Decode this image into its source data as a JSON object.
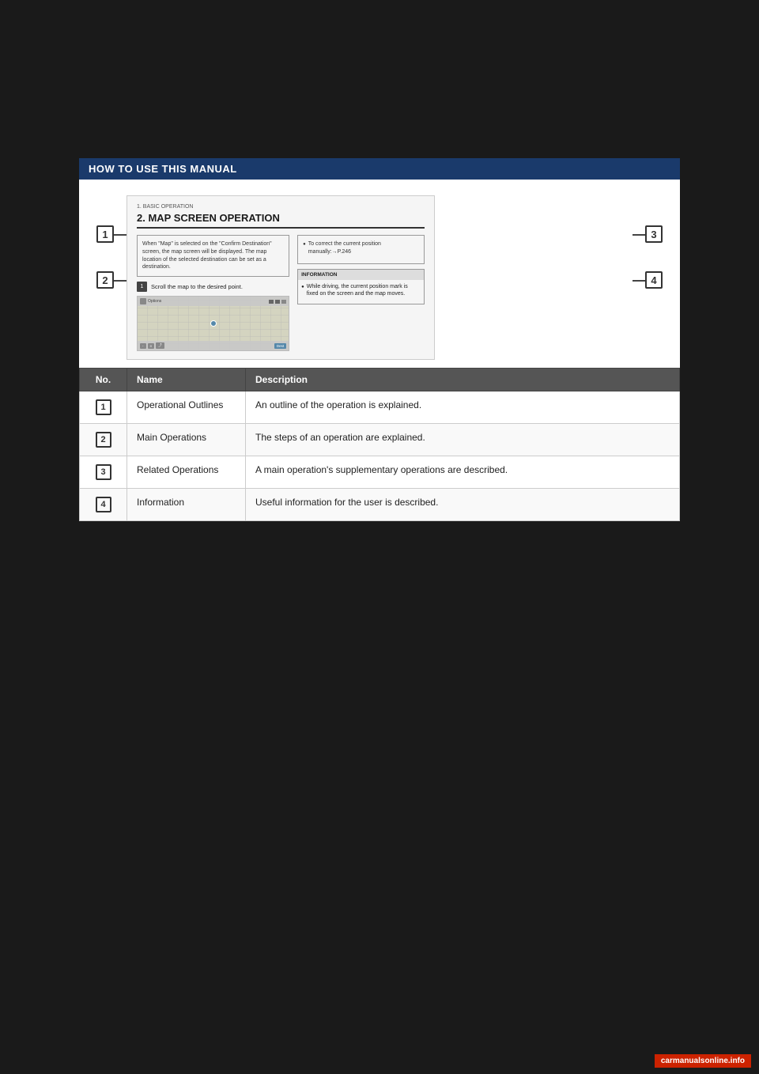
{
  "page": {
    "background_color": "#1a1a1a",
    "watermark": "carmanualsonline.info"
  },
  "section_header": {
    "text": "HOW TO USE THIS MANUAL"
  },
  "manual_page": {
    "header": "1. BASIC OPERATION",
    "title": "2. MAP SCREEN OPERATION",
    "outline_text": "When \"Map\" is selected on the \"Confirm Destination\" screen, the map screen will be displayed. The map location of the selected destination can be set as a destination.",
    "right_bullet": "To correct the current position manually:→P.246",
    "info_header": "INFORMATION",
    "info_text": "While driving, the current position mark is fixed on the screen and the map moves.",
    "step_label": "1",
    "step_text": "Scroll the map to the desired point."
  },
  "table": {
    "headers": [
      "No.",
      "Name",
      "Description"
    ],
    "rows": [
      {
        "num": "1",
        "name": "Operational Outlines",
        "description": "An outline of the operation is explained."
      },
      {
        "num": "2",
        "name": "Main Operations",
        "description": "The steps of an operation are explained."
      },
      {
        "num": "3",
        "name": "Related Operations",
        "description": "A main operation's supplementary operations are described."
      },
      {
        "num": "4",
        "name": "Information",
        "description": "Useful information for the user is described."
      }
    ]
  },
  "callouts": [
    "1",
    "2",
    "3",
    "4"
  ]
}
